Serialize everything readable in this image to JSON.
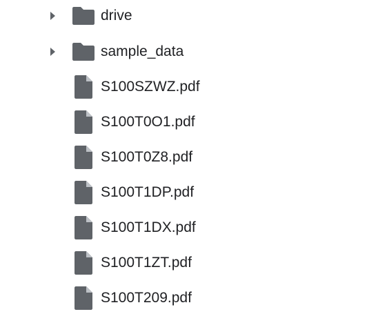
{
  "file_browser": {
    "items": [
      {
        "name": "drive",
        "type": "folder",
        "icon": "folder-icon",
        "expand_icon": "chevron-right-icon"
      },
      {
        "name": "sample_data",
        "type": "folder",
        "icon": "folder-icon",
        "expand_icon": "chevron-right-icon"
      },
      {
        "name": "S100SZWZ.pdf",
        "type": "file",
        "icon": "file-icon"
      },
      {
        "name": "S100T0O1.pdf",
        "type": "file",
        "icon": "file-icon"
      },
      {
        "name": "S100T0Z8.pdf",
        "type": "file",
        "icon": "file-icon"
      },
      {
        "name": "S100T1DP.pdf",
        "type": "file",
        "icon": "file-icon"
      },
      {
        "name": "S100T1DX.pdf",
        "type": "file",
        "icon": "file-icon"
      },
      {
        "name": "S100T1ZT.pdf",
        "type": "file",
        "icon": "file-icon"
      },
      {
        "name": "S100T209.pdf",
        "type": "file",
        "icon": "file-icon"
      }
    ],
    "colors": {
      "icon": "#5f6368",
      "text": "#202124"
    }
  }
}
